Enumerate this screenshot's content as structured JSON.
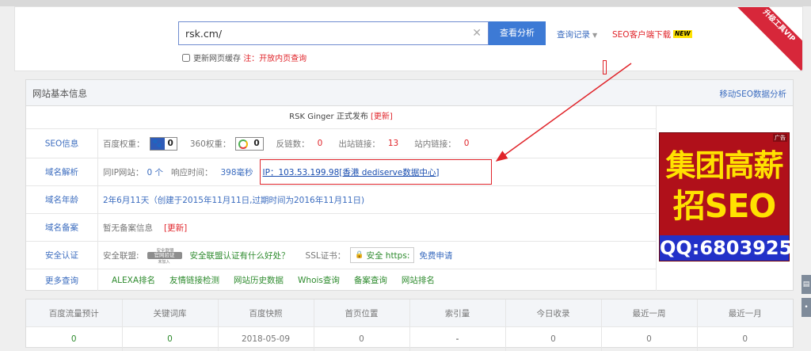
{
  "search": {
    "query": "rsk.cm/",
    "analyze_label": "查看分析",
    "history_label": "查询记录",
    "seo_client_label": "SEO客户端下载",
    "new_badge": "NEW",
    "cache_label": "更新网页缓存",
    "cache_note": "注：开放内页查询",
    "vip_ribbon": "升级工具VIP"
  },
  "panel": {
    "title": "网站基本信息",
    "mobile_link": "移动SEO数据分析",
    "announcement": "RSK Ginger 正式发布",
    "announcement_update": "[更新]"
  },
  "seo_info": {
    "label": "SEO信息",
    "baidu_weight_label": "百度权重：",
    "baidu_weight": "0",
    "w360_label": "360权重：",
    "w360": "0",
    "backlinks_label": "反链数：",
    "backlinks": "0",
    "outbound_label": "出站链接：",
    "outbound": "13",
    "internal_label": "站内链接：",
    "internal": "0"
  },
  "domain_resolve": {
    "label": "域名解析",
    "same_ip_label": "同IP网站：",
    "same_ip": "0 个",
    "response_label": "响应时间：",
    "response": "398毫秒",
    "ip_text": "IP：103.53.199.98[香港 dediserve数据中心]"
  },
  "domain_age": {
    "label": "域名年龄",
    "value": "2年6月11天（创建于2015年11月11日,过期时间为2016年11月11日)"
  },
  "domain_icp": {
    "label": "域名备案",
    "value": "暂无备案信息",
    "update": "[更新]"
  },
  "security": {
    "label": "安全认证",
    "alliance_label": "安全联盟:",
    "seal_top": "安全联盟",
    "seal_text": "官网验证",
    "seal_bottom": "未加入",
    "alliance_link": "安全联盟认证有什么好处？",
    "ssl_label": "SSL证书：",
    "ssl_badge": "安全 https:",
    "free_apply": "免费申请"
  },
  "more": {
    "label": "更多查询",
    "links": [
      "ALEXA排名",
      "友情链接检测",
      "网站历史数据",
      "Whois查询",
      "备案查询",
      "网站排名"
    ]
  },
  "ad": {
    "tag": "广告",
    "line1": "集团高薪",
    "line2": "招SEO",
    "qq": "QQ:6803925"
  },
  "stats": {
    "headers": [
      "百度流量预计",
      "关键词库",
      "百度快照",
      "首页位置",
      "索引量",
      "今日收录",
      "最近一周",
      "最近一月"
    ],
    "values": [
      "0",
      "0",
      "2018-05-09",
      "0",
      "-",
      "0",
      "0",
      "0"
    ]
  },
  "colors": {
    "accent": "#3d7ad5",
    "link": "#3b6cbf",
    "alert": "#e0242a",
    "positive": "#2e8b2e"
  }
}
